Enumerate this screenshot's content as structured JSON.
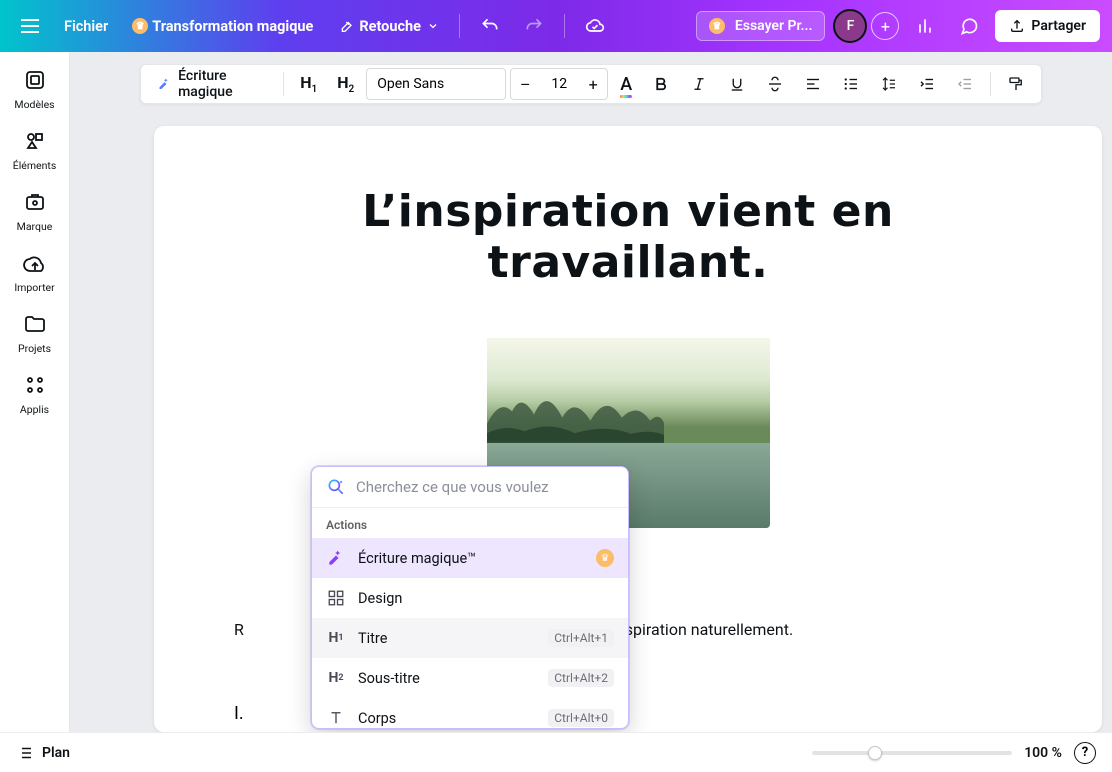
{
  "topbar": {
    "file": "Fichier",
    "magic_transform": "Transformation magique",
    "retouche": "Retouche",
    "try_pro": "Essayer Pr...",
    "avatar_initial": "F",
    "share": "Partager"
  },
  "leftrail": {
    "items": [
      {
        "label": "Modèles"
      },
      {
        "label": "Éléments"
      },
      {
        "label": "Marque"
      },
      {
        "label": "Importer"
      },
      {
        "label": "Projets"
      },
      {
        "label": "Applis"
      }
    ]
  },
  "text_toolbar": {
    "magic_write": "Écriture magique",
    "h1": "H",
    "h1_sub": "1",
    "h2": "H",
    "h2_sub": "2",
    "font": "Open Sans",
    "minus": "–",
    "size": "12",
    "plus": "+",
    "color_letter": "A"
  },
  "document": {
    "title": "L’inspiration vient en travaillant.",
    "sentence_part1": "R",
    "sentence_part2": "ouver l'inspiration naturellement.",
    "cursorline": "I."
  },
  "popover": {
    "search_placeholder": "Cherchez ce que vous voulez",
    "header": "Actions",
    "items": [
      {
        "label": "Écriture magique™",
        "shortcut": "",
        "crown": true
      },
      {
        "label": "Design",
        "shortcut": "",
        "crown": false
      },
      {
        "label": "Titre",
        "shortcut": "Ctrl+Alt+1",
        "crown": false
      },
      {
        "label": "Sous-titre",
        "shortcut": "Ctrl+Alt+2",
        "crown": false
      },
      {
        "label": "Corps",
        "shortcut": "Ctrl+Alt+0",
        "crown": false
      }
    ]
  },
  "footer": {
    "plan": "Plan",
    "zoom": "100 %"
  }
}
